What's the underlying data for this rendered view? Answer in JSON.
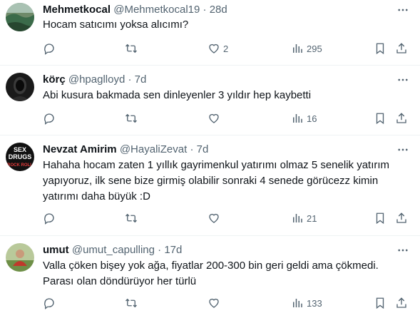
{
  "tweets": [
    {
      "name": "Mehmetkocal",
      "handle": "@Mehmetkocal19",
      "sep": "·",
      "time": "28d",
      "lines": [
        "Hocam satıcımı yoksa alıcımı?"
      ],
      "likes": "2",
      "views": "295",
      "avatar_color": "#3b6b4a"
    },
    {
      "name": "körç",
      "handle": "@hpaglloyd",
      "sep": "·",
      "time": "7d",
      "lines": [
        "Abi kusura bakmada sen dinleyenler 3 yıldır hep kaybetti"
      ],
      "likes": "",
      "views": "16",
      "avatar_color": "#1a1a1a"
    },
    {
      "name": "Nevzat Amirim",
      "handle": "@HayaliZevat",
      "sep": "·",
      "time": "7d",
      "lines": [
        "Hahaha hocam zaten 1 yıllık gayrimenkul yatırımı olmaz 5 senelik yatırım",
        "yapıyoruz, ilk sene bize girmiş olabilir sonraki 4 senede görücezz kimin",
        "yatırımı daha büyük :D"
      ],
      "likes": "",
      "views": "21",
      "avatar_color": "#111111",
      "avatar_text": [
        "SEX",
        "DRUGS",
        "ROCK ROLL"
      ]
    },
    {
      "name": "umut",
      "handle": "@umut_capulling",
      "sep": "·",
      "time": "17d",
      "lines": [
        "Valla çöken bişey yok ağa, fiyatlar 200-300 bin geri geldi ama çökmedi.",
        "Parası olan döndürüyor her türlü"
      ],
      "likes": "",
      "views": "133",
      "avatar_color": "#8fa86a"
    }
  ],
  "icons": {
    "more": "more-dots-icon",
    "reply": "reply-icon",
    "retweet": "retweet-icon",
    "like": "heart-icon",
    "views": "views-chart-icon",
    "bookmark": "bookmark-icon",
    "share": "share-icon"
  },
  "colors": {
    "text": "#0f1419",
    "muted": "#536471",
    "divider": "#eff3f4"
  }
}
